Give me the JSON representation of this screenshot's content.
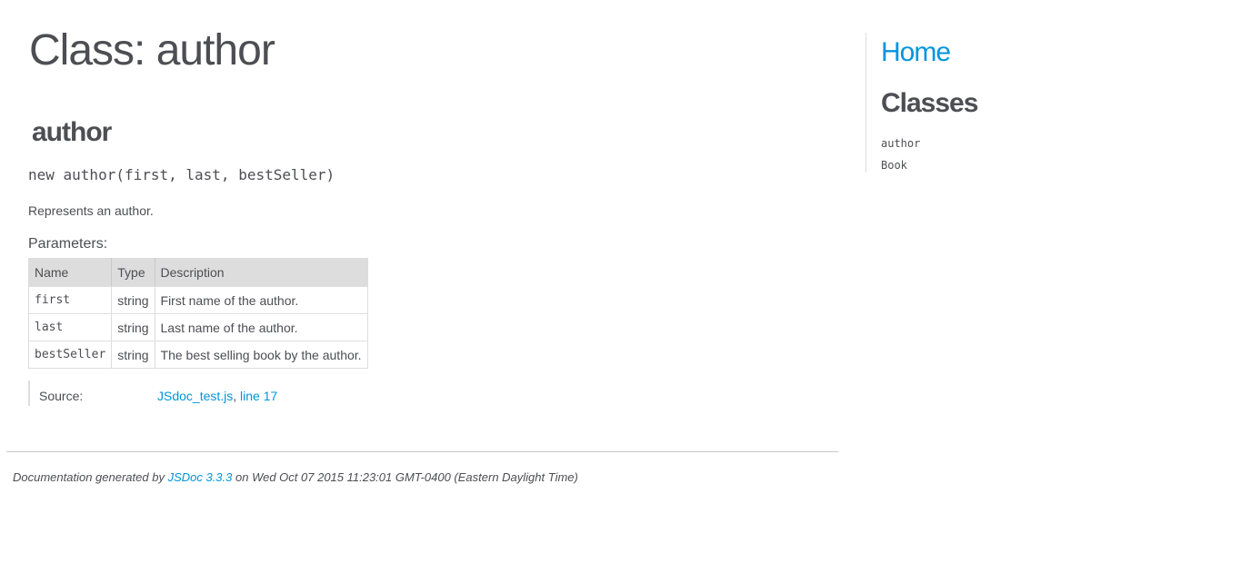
{
  "page": {
    "title": "Class: author"
  },
  "class_section": {
    "name": "author",
    "signature": "new author(first, last, bestSeller)",
    "description": "Represents an author.",
    "params_heading": "Parameters:",
    "params_table": {
      "headers": [
        "Name",
        "Type",
        "Description"
      ],
      "rows": [
        {
          "name": "first",
          "type": "string",
          "description": "First name of the author."
        },
        {
          "name": "last",
          "type": "string",
          "description": "Last name of the author."
        },
        {
          "name": "bestSeller",
          "type": "string",
          "description": "The best selling book by the author."
        }
      ]
    },
    "source": {
      "label": "Source:",
      "file": "JSdoc_test.js",
      "separator": ", ",
      "line": "line 17"
    }
  },
  "footer": {
    "prefix": "Documentation generated by ",
    "generator_link": "JSDoc 3.3.3",
    "suffix": " on Wed Oct 07 2015 11:23:01 GMT-0400 (Eastern Daylight Time)"
  },
  "nav": {
    "home": "Home",
    "classes_heading": "Classes",
    "classes": [
      "author",
      "Book"
    ]
  },
  "colors": {
    "text": "#4d4e53",
    "link": "#0095dd",
    "table_header_bg": "#dddddd"
  }
}
